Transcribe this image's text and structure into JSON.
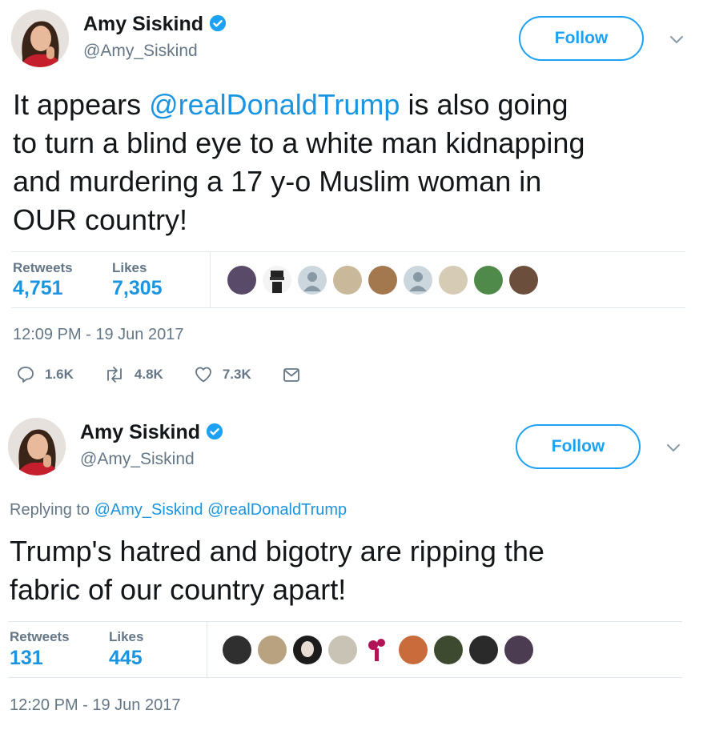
{
  "colors": {
    "link": "#1b95e0",
    "text": "#14171a",
    "muted": "#657786",
    "divider": "#e1e8ed",
    "accent": "#1da1f2"
  },
  "tweets": [
    {
      "author": {
        "name": "Amy Siskind",
        "handle": "@Amy_Siskind",
        "verified": true
      },
      "follow_label": "Follow",
      "menu_icon": "chevron-down-icon",
      "text_lines": [
        {
          "pre": "It appears ",
          "mention": "@realDonaldTrump",
          "post": " is also going"
        },
        {
          "pre": "to turn a blind eye to a white man kidnapping"
        },
        {
          "pre": "and murdering a 17 y-o Muslim woman in"
        },
        {
          "pre": "OUR country!"
        }
      ],
      "stats": {
        "retweets_label": "Retweets",
        "retweets": "4,751",
        "likes_label": "Likes",
        "likes": "7,305"
      },
      "likers_count": 10,
      "timestamp": "12:09 PM - 19 Jun 2017",
      "actions": {
        "replies": "1.6K",
        "retweets": "4.8K",
        "likes": "7.3K"
      }
    },
    {
      "author": {
        "name": "Amy Siskind",
        "handle": "@Amy_Siskind",
        "verified": true
      },
      "follow_label": "Follow",
      "menu_icon": "chevron-down-icon",
      "replying": {
        "prefix": "Replying to",
        "mentions": [
          "@Amy_Siskind",
          "@realDonaldTrump"
        ]
      },
      "text_lines": [
        {
          "pre": "Trump's hatred and bigotry are ripping the"
        },
        {
          "pre": "fabric of our country apart!"
        }
      ],
      "stats": {
        "retweets_label": "Retweets",
        "retweets": "131",
        "likes_label": "Likes",
        "likes": "445"
      },
      "likers_count": 10,
      "timestamp": "12:20 PM - 19 Jun 2017"
    }
  ]
}
